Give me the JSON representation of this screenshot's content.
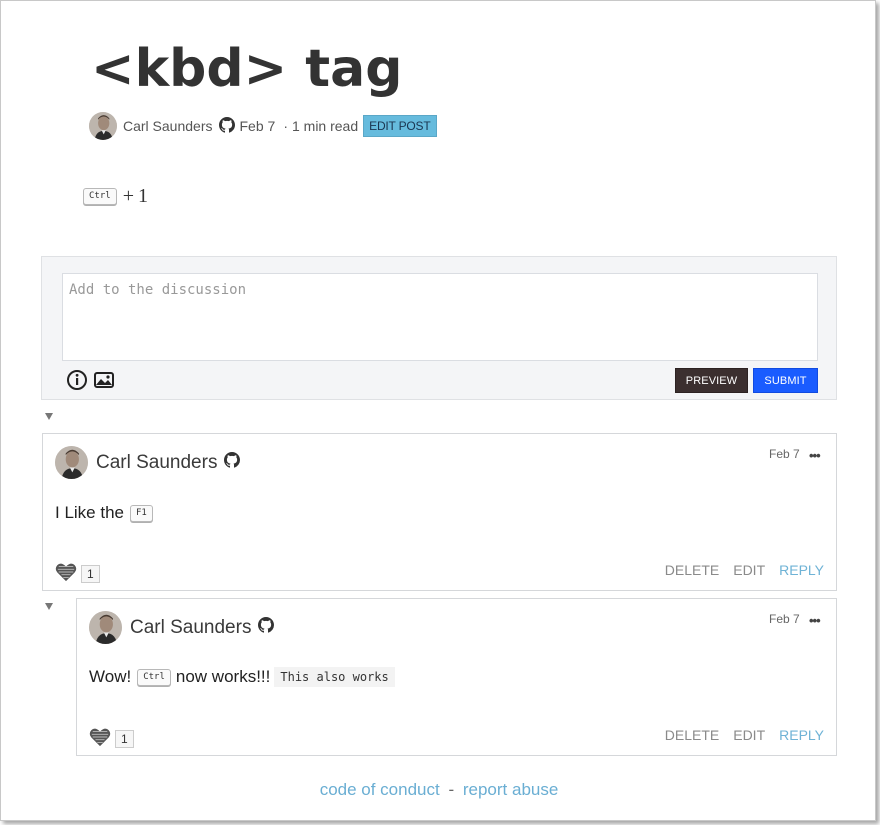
{
  "post": {
    "title": "<kbd> tag",
    "author": "Carl Saunders",
    "date": "Feb 7",
    "separator": "·",
    "read_time": "1 min read",
    "edit_label": "EDIT POST",
    "body_kbd": "Ctrl",
    "body_plus": "+",
    "body_key": "1"
  },
  "composer": {
    "placeholder": "Add to the discussion",
    "preview_label": "PREVIEW",
    "submit_label": "SUBMIT"
  },
  "comments": [
    {
      "author": "Carl Saunders",
      "date": "Feb 7",
      "dots": "•••",
      "text_before": "I Like the",
      "kbd": "F1",
      "likes": "1",
      "delete_label": "DELETE",
      "edit_label": "EDIT",
      "reply_label": "REPLY"
    },
    {
      "author": "Carl Saunders",
      "date": "Feb 7",
      "dots": "•••",
      "text_before": "Wow!",
      "kbd": "Ctrl",
      "text_after": "now works!!!",
      "code": "This also works",
      "likes": "1",
      "delete_label": "DELETE",
      "edit_label": "EDIT",
      "reply_label": "REPLY"
    }
  ],
  "footer": {
    "conduct_label": "code of conduct",
    "dash": "-",
    "abuse_label": "report abuse"
  },
  "icons": {
    "github": "github-icon",
    "info": "info-icon",
    "image": "image-upload-icon",
    "heart": "heart-icon",
    "collapse": "collapse-arrow-icon"
  },
  "colors": {
    "edit_post_bg": "#66bbdd",
    "preview_bg": "#3b2f2f",
    "submit_bg": "#1a5cff",
    "reply_link": "#6fb3d6",
    "footer_link": "#6aaed3"
  }
}
